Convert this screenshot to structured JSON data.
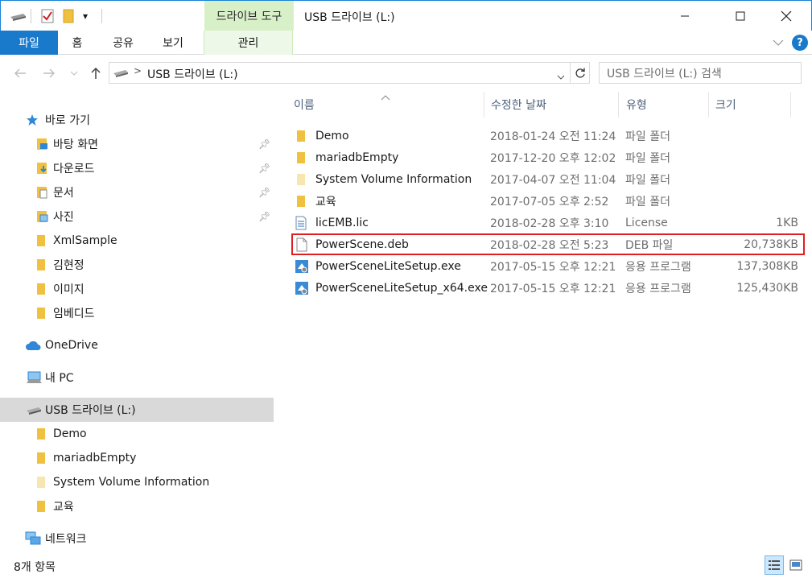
{
  "titlebar": {
    "context_tab": "드라이브 도구",
    "title": "USB 드라이브 (L:)",
    "qa_dropdown": "▾"
  },
  "ribbon": {
    "tabs": [
      "파일",
      "홈",
      "공유",
      "보기",
      "관리"
    ],
    "help": "?"
  },
  "address": {
    "path_sep": ">",
    "path": "USB 드라이브 (L:)",
    "search_placeholder": "USB 드라이브 (L:) 검색"
  },
  "nav": {
    "quick_access": "바로 가기",
    "pinned": [
      "바탕 화면",
      "다운로드",
      "문서",
      "사진"
    ],
    "quick_folders": [
      "XmlSample",
      "김현정",
      "이미지",
      "임베디드"
    ],
    "onedrive": "OneDrive",
    "thispc": "내 PC",
    "usb": "USB 드라이브 (L:)",
    "usb_folders": [
      "Demo",
      "mariadbEmpty",
      "System Volume Information",
      "교육"
    ],
    "network": "네트워크"
  },
  "columns": {
    "name": "이름",
    "date": "수정한 날짜",
    "type": "유형",
    "size": "크기"
  },
  "files": [
    {
      "name": "Demo",
      "date": "2018-01-24 오전 11:24",
      "type": "파일 폴더",
      "size": "",
      "icon": "folder"
    },
    {
      "name": "mariadbEmpty",
      "date": "2017-12-20 오후 12:02",
      "type": "파일 폴더",
      "size": "",
      "icon": "folder"
    },
    {
      "name": "System Volume Information",
      "date": "2017-04-07 오전 11:04",
      "type": "파일 폴더",
      "size": "",
      "icon": "folder-pale"
    },
    {
      "name": "교육",
      "date": "2017-07-05 오후 2:52",
      "type": "파일 폴더",
      "size": "",
      "icon": "folder"
    },
    {
      "name": "licEMB.lic",
      "date": "2018-02-28 오후 3:10",
      "type": "License",
      "size": "1KB",
      "icon": "text-file"
    },
    {
      "name": "PowerScene.deb",
      "date": "2018-02-28 오전 5:23",
      "type": "DEB 파일",
      "size": "20,738KB",
      "icon": "blank-file"
    },
    {
      "name": "PowerSceneLiteSetup.exe",
      "date": "2017-05-15 오후 12:21",
      "type": "응용 프로그램",
      "size": "137,308KB",
      "icon": "setup-exe"
    },
    {
      "name": "PowerSceneLiteSetup_x64.exe",
      "date": "2017-05-15 오후 12:21",
      "type": "응용 프로그램",
      "size": "125,430KB",
      "icon": "setup-exe"
    }
  ],
  "status": {
    "count": "8개 항목"
  },
  "colors": {
    "accent": "#1979ca",
    "context_tab": "#d8f0c8",
    "folder": "#f0c040",
    "highlight_border": "#e02020",
    "selection": "#d9d9d9"
  }
}
